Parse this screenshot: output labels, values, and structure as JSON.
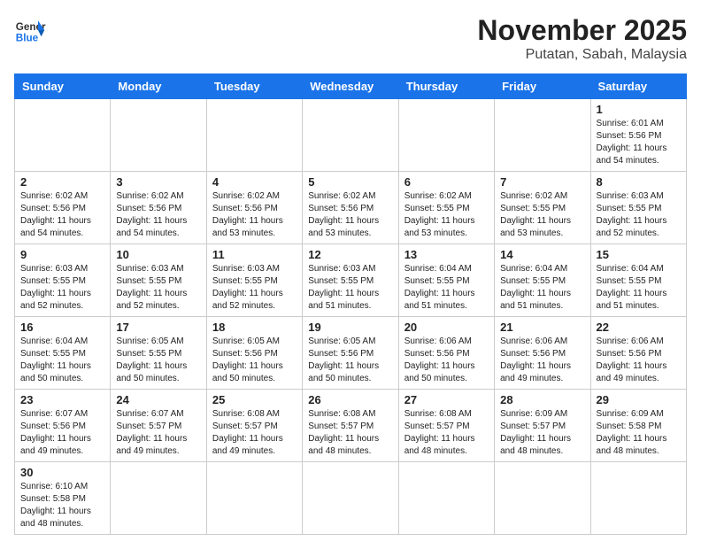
{
  "header": {
    "logo_general": "General",
    "logo_blue": "Blue",
    "month_title": "November 2025",
    "location": "Putatan, Sabah, Malaysia"
  },
  "days_of_week": [
    "Sunday",
    "Monday",
    "Tuesday",
    "Wednesday",
    "Thursday",
    "Friday",
    "Saturday"
  ],
  "weeks": [
    [
      {
        "day": null
      },
      {
        "day": null
      },
      {
        "day": null
      },
      {
        "day": null
      },
      {
        "day": null
      },
      {
        "day": null
      },
      {
        "day": 1,
        "sunrise": "Sunrise: 6:01 AM",
        "sunset": "Sunset: 5:56 PM",
        "daylight": "Daylight: 11 hours and 54 minutes."
      }
    ],
    [
      {
        "day": 2,
        "sunrise": "Sunrise: 6:02 AM",
        "sunset": "Sunset: 5:56 PM",
        "daylight": "Daylight: 11 hours and 54 minutes."
      },
      {
        "day": 3,
        "sunrise": "Sunrise: 6:02 AM",
        "sunset": "Sunset: 5:56 PM",
        "daylight": "Daylight: 11 hours and 54 minutes."
      },
      {
        "day": 4,
        "sunrise": "Sunrise: 6:02 AM",
        "sunset": "Sunset: 5:56 PM",
        "daylight": "Daylight: 11 hours and 53 minutes."
      },
      {
        "day": 5,
        "sunrise": "Sunrise: 6:02 AM",
        "sunset": "Sunset: 5:56 PM",
        "daylight": "Daylight: 11 hours and 53 minutes."
      },
      {
        "day": 6,
        "sunrise": "Sunrise: 6:02 AM",
        "sunset": "Sunset: 5:55 PM",
        "daylight": "Daylight: 11 hours and 53 minutes."
      },
      {
        "day": 7,
        "sunrise": "Sunrise: 6:02 AM",
        "sunset": "Sunset: 5:55 PM",
        "daylight": "Daylight: 11 hours and 53 minutes."
      },
      {
        "day": 8,
        "sunrise": "Sunrise: 6:03 AM",
        "sunset": "Sunset: 5:55 PM",
        "daylight": "Daylight: 11 hours and 52 minutes."
      }
    ],
    [
      {
        "day": 9,
        "sunrise": "Sunrise: 6:03 AM",
        "sunset": "Sunset: 5:55 PM",
        "daylight": "Daylight: 11 hours and 52 minutes."
      },
      {
        "day": 10,
        "sunrise": "Sunrise: 6:03 AM",
        "sunset": "Sunset: 5:55 PM",
        "daylight": "Daylight: 11 hours and 52 minutes."
      },
      {
        "day": 11,
        "sunrise": "Sunrise: 6:03 AM",
        "sunset": "Sunset: 5:55 PM",
        "daylight": "Daylight: 11 hours and 52 minutes."
      },
      {
        "day": 12,
        "sunrise": "Sunrise: 6:03 AM",
        "sunset": "Sunset: 5:55 PM",
        "daylight": "Daylight: 11 hours and 51 minutes."
      },
      {
        "day": 13,
        "sunrise": "Sunrise: 6:04 AM",
        "sunset": "Sunset: 5:55 PM",
        "daylight": "Daylight: 11 hours and 51 minutes."
      },
      {
        "day": 14,
        "sunrise": "Sunrise: 6:04 AM",
        "sunset": "Sunset: 5:55 PM",
        "daylight": "Daylight: 11 hours and 51 minutes."
      },
      {
        "day": 15,
        "sunrise": "Sunrise: 6:04 AM",
        "sunset": "Sunset: 5:55 PM",
        "daylight": "Daylight: 11 hours and 51 minutes."
      }
    ],
    [
      {
        "day": 16,
        "sunrise": "Sunrise: 6:04 AM",
        "sunset": "Sunset: 5:55 PM",
        "daylight": "Daylight: 11 hours and 50 minutes."
      },
      {
        "day": 17,
        "sunrise": "Sunrise: 6:05 AM",
        "sunset": "Sunset: 5:55 PM",
        "daylight": "Daylight: 11 hours and 50 minutes."
      },
      {
        "day": 18,
        "sunrise": "Sunrise: 6:05 AM",
        "sunset": "Sunset: 5:56 PM",
        "daylight": "Daylight: 11 hours and 50 minutes."
      },
      {
        "day": 19,
        "sunrise": "Sunrise: 6:05 AM",
        "sunset": "Sunset: 5:56 PM",
        "daylight": "Daylight: 11 hours and 50 minutes."
      },
      {
        "day": 20,
        "sunrise": "Sunrise: 6:06 AM",
        "sunset": "Sunset: 5:56 PM",
        "daylight": "Daylight: 11 hours and 50 minutes."
      },
      {
        "day": 21,
        "sunrise": "Sunrise: 6:06 AM",
        "sunset": "Sunset: 5:56 PM",
        "daylight": "Daylight: 11 hours and 49 minutes."
      },
      {
        "day": 22,
        "sunrise": "Sunrise: 6:06 AM",
        "sunset": "Sunset: 5:56 PM",
        "daylight": "Daylight: 11 hours and 49 minutes."
      }
    ],
    [
      {
        "day": 23,
        "sunrise": "Sunrise: 6:07 AM",
        "sunset": "Sunset: 5:56 PM",
        "daylight": "Daylight: 11 hours and 49 minutes."
      },
      {
        "day": 24,
        "sunrise": "Sunrise: 6:07 AM",
        "sunset": "Sunset: 5:57 PM",
        "daylight": "Daylight: 11 hours and 49 minutes."
      },
      {
        "day": 25,
        "sunrise": "Sunrise: 6:08 AM",
        "sunset": "Sunset: 5:57 PM",
        "daylight": "Daylight: 11 hours and 49 minutes."
      },
      {
        "day": 26,
        "sunrise": "Sunrise: 6:08 AM",
        "sunset": "Sunset: 5:57 PM",
        "daylight": "Daylight: 11 hours and 48 minutes."
      },
      {
        "day": 27,
        "sunrise": "Sunrise: 6:08 AM",
        "sunset": "Sunset: 5:57 PM",
        "daylight": "Daylight: 11 hours and 48 minutes."
      },
      {
        "day": 28,
        "sunrise": "Sunrise: 6:09 AM",
        "sunset": "Sunset: 5:57 PM",
        "daylight": "Daylight: 11 hours and 48 minutes."
      },
      {
        "day": 29,
        "sunrise": "Sunrise: 6:09 AM",
        "sunset": "Sunset: 5:58 PM",
        "daylight": "Daylight: 11 hours and 48 minutes."
      }
    ],
    [
      {
        "day": 30,
        "sunrise": "Sunrise: 6:10 AM",
        "sunset": "Sunset: 5:58 PM",
        "daylight": "Daylight: 11 hours and 48 minutes."
      },
      {
        "day": null
      },
      {
        "day": null
      },
      {
        "day": null
      },
      {
        "day": null
      },
      {
        "day": null
      },
      {
        "day": null
      }
    ]
  ]
}
